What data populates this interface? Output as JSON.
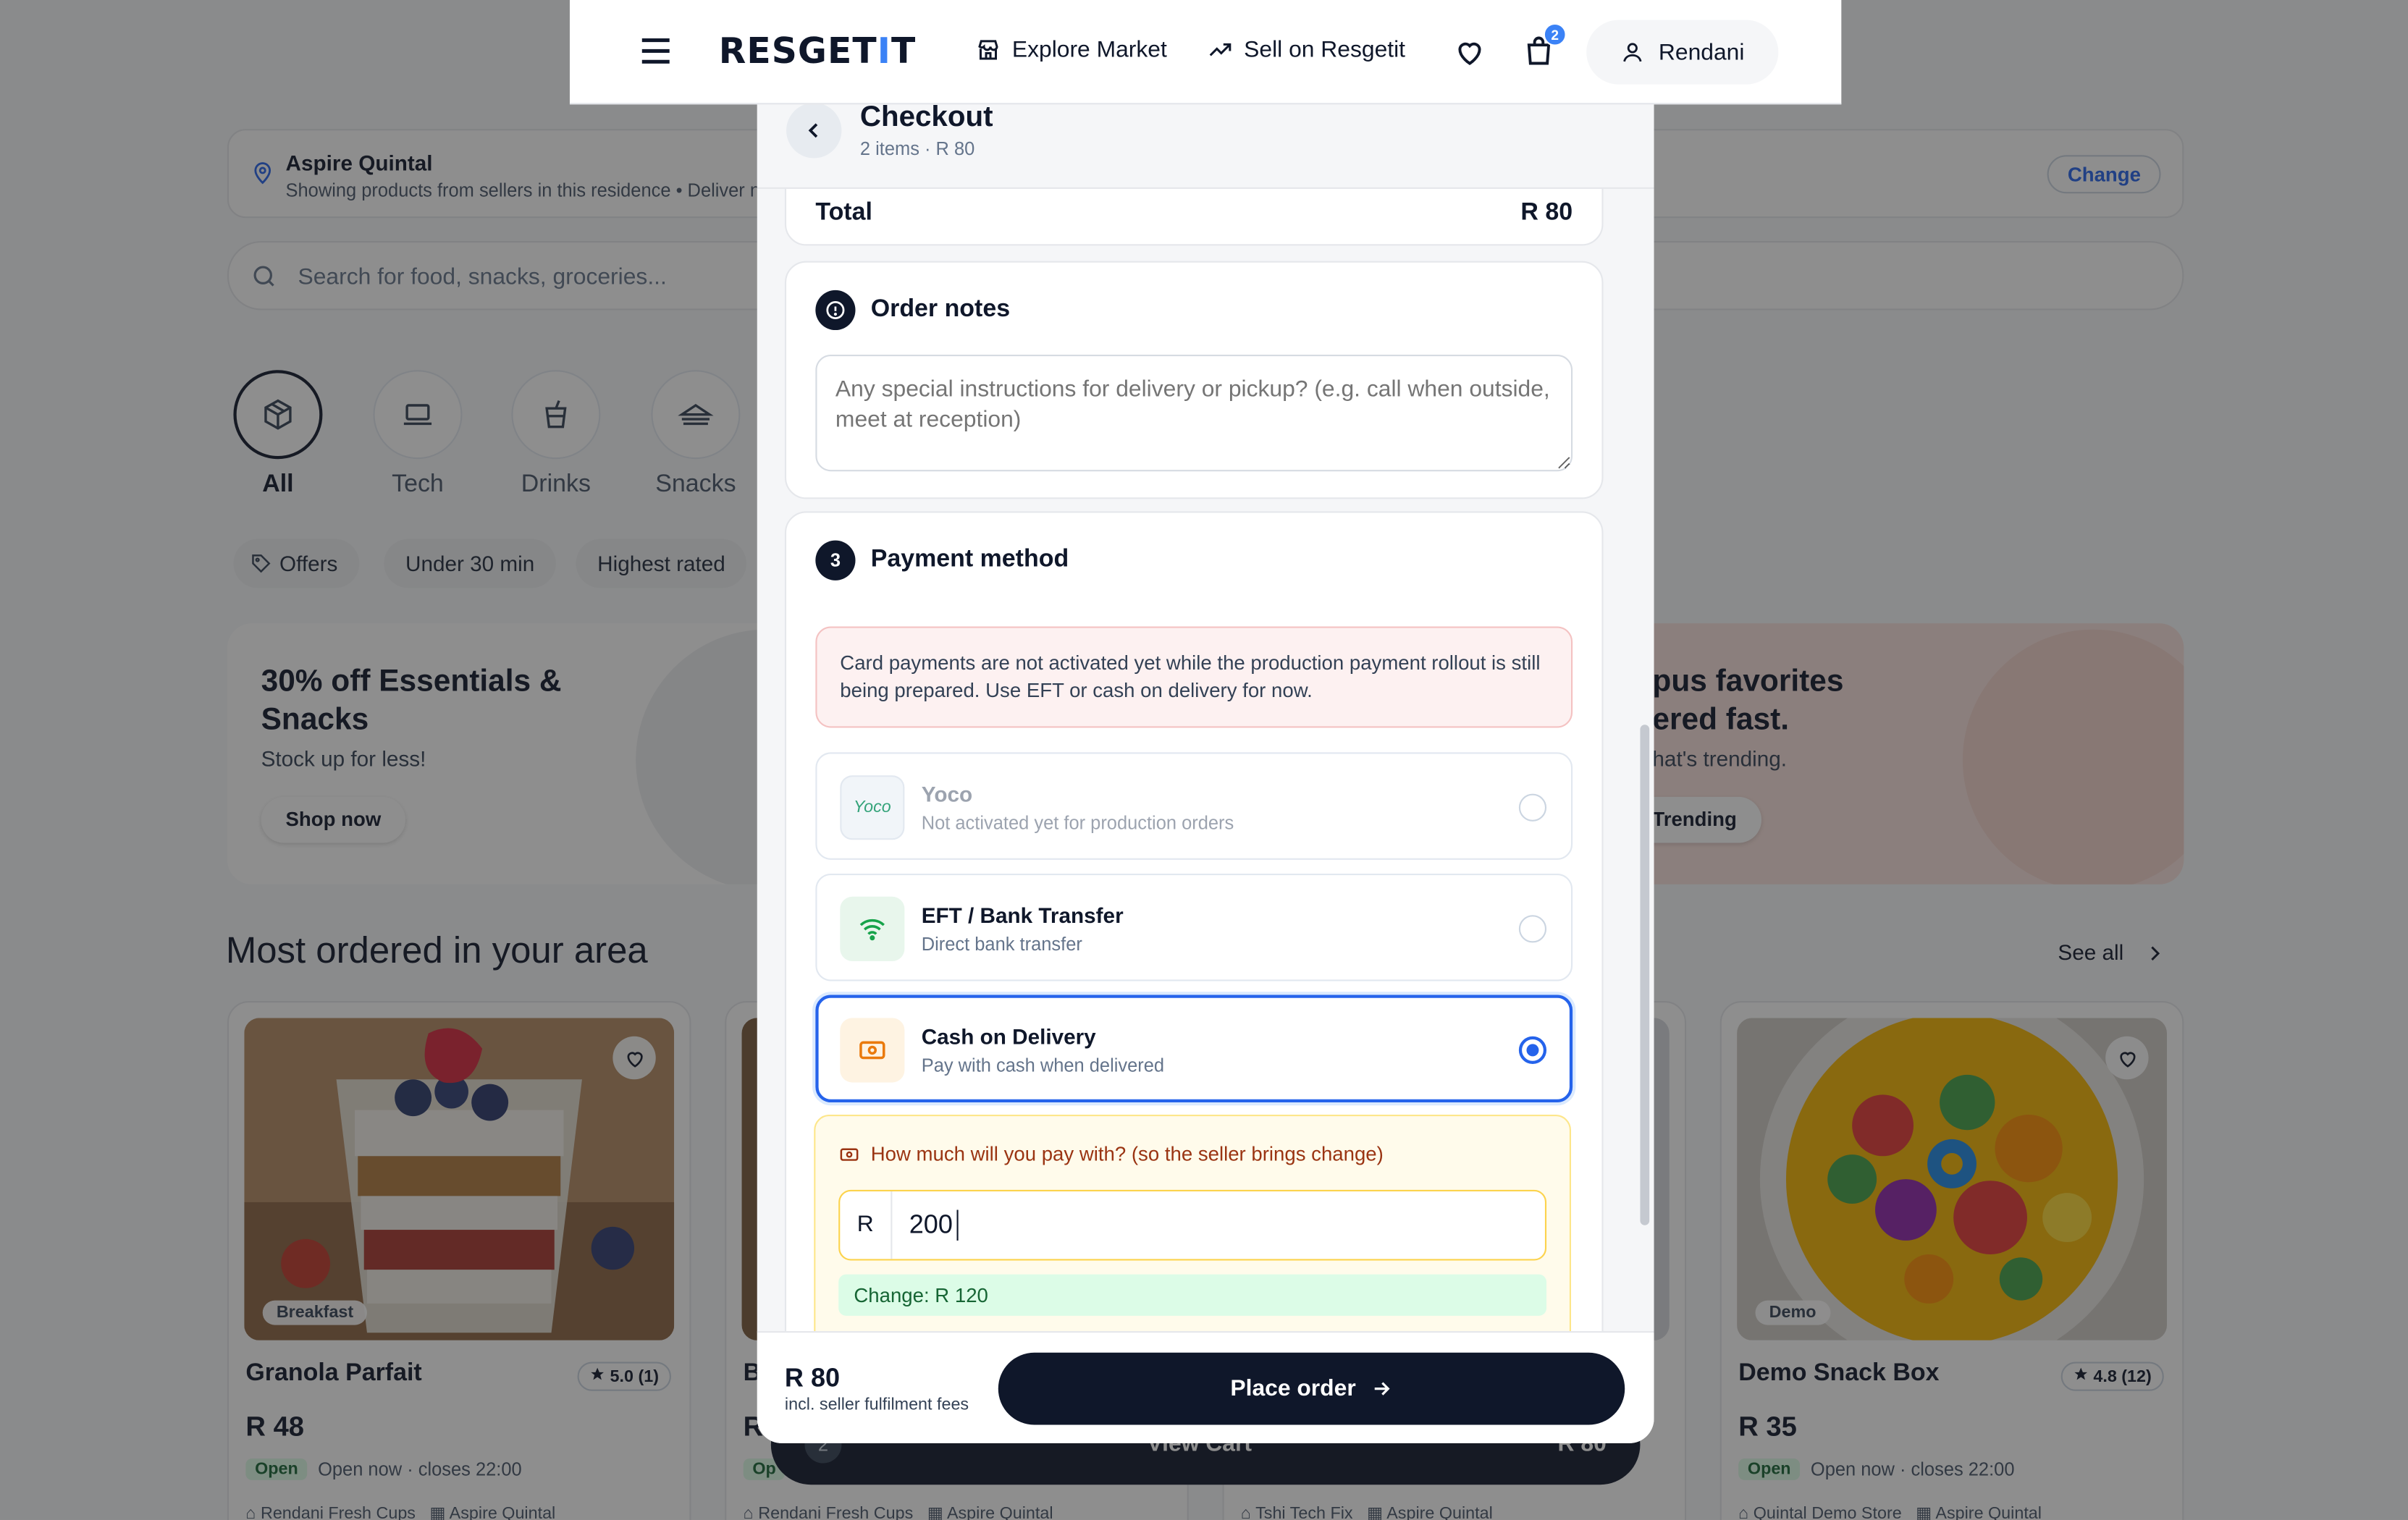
{
  "header": {
    "brand_part1": "RESGET",
    "brand_i": "I",
    "brand_part2": "T",
    "explore": "Explore Market",
    "sell": "Sell on Resgetit",
    "cart_count": "2",
    "user": "Rendani"
  },
  "background": {
    "location_name": "Aspire Quintal",
    "location_sub": "Showing products from sellers in this residence • Deliver n",
    "change": "Change",
    "search_placeholder": "Search for food, snacks, groceries...",
    "categories": [
      "All",
      "Tech",
      "Drinks",
      "Snacks"
    ],
    "chips": [
      "Offers",
      "Under 30 min",
      "Highest rated"
    ],
    "promo_left": {
      "title": "30% off Essentials & Snacks",
      "text": "Stock up for less!",
      "button": "Shop now"
    },
    "promo_right": {
      "title_line1": "pus favorites",
      "title_line2": "ered fast.",
      "text": "hat's trending.",
      "button": "Trending"
    },
    "section_title": "Most ordered in your area",
    "see_all": "See all",
    "cards": [
      {
        "tag": "Breakfast",
        "title": "Granola Parfait",
        "rating": "5.0 (1)",
        "price": "R 48",
        "status": "Open",
        "hours": "Open now · closes 22:00",
        "seller": "Rendani Fresh Cups",
        "residence": "Aspire Quintal"
      },
      {
        "title_frag": "B",
        "price_frag": "R",
        "status_frag": "Op",
        "seller": "Rendani Fresh Cups",
        "residence": "Aspire Quintal"
      },
      {
        "seller": "Tshi Tech Fix",
        "residence": "Aspire Quintal"
      },
      {
        "tag": "Demo",
        "title": "Demo Snack Box",
        "rating": "4.8 (12)",
        "price": "R 35",
        "status": "Open",
        "hours": "Open now · closes 22:00",
        "seller": "Quintal Demo Store",
        "residence": "Aspire Quintal"
      }
    ],
    "view_cart": {
      "count": "2",
      "label": "View Cart",
      "price": "R 80"
    }
  },
  "checkout": {
    "title": "Checkout",
    "subtitle": "2 items · R 80",
    "total_label": "Total",
    "total_value": "R 80",
    "notes_title": "Order notes",
    "notes_placeholder": "Any special instructions for delivery or pickup? (e.g. call when outside, meet at reception)",
    "payment_step": "3",
    "payment_title": "Payment method",
    "warning": "Card payments are not activated yet while the production payment rollout is still being prepared. Use EFT or cash on delivery for now.",
    "methods": [
      {
        "logo": "Yoco",
        "name": "Yoco",
        "desc": "Not activated yet for production orders",
        "state": "disabled"
      },
      {
        "name": "EFT / Bank Transfer",
        "desc": "Direct bank transfer",
        "state": "unselected",
        "icon": "wifi-icon"
      },
      {
        "name": "Cash on Delivery",
        "desc": "Pay with cash when delivered",
        "state": "selected",
        "icon": "cash-icon"
      }
    ],
    "cash_question": "How much will you pay with? (so the seller brings change)",
    "currency": "R",
    "cash_amount": "200",
    "change_text": "Change: R 120",
    "footer_amount": "R 80",
    "footer_fee": "incl. seller fulfilment fees",
    "place_order": "Place order"
  },
  "colors": {
    "primary": "#0f172a",
    "accent": "#2563eb",
    "warning_bg": "#fdf1f1",
    "cash_bg": "#fffbeb",
    "change_bg": "#dcfce7"
  }
}
